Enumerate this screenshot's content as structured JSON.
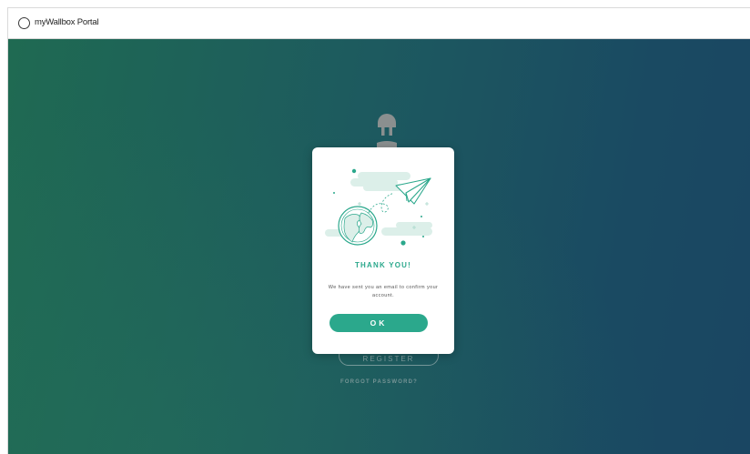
{
  "window": {
    "title": "myWallbox Portal"
  },
  "background": {
    "register_label": "REGISTER",
    "forgot_password_label": "FORGOT PASSWORD?"
  },
  "modal": {
    "title": "THANK YOU!",
    "message": "We have sent you an email to confirm your account.",
    "ok_label": "OK"
  },
  "colors": {
    "accent": "#2ba88c",
    "background_start": "#1f6a52",
    "background_end": "#1a4662"
  },
  "icons": {
    "plug": "plug-logo-icon",
    "illustration": "paper-plane-globe-illustration"
  }
}
